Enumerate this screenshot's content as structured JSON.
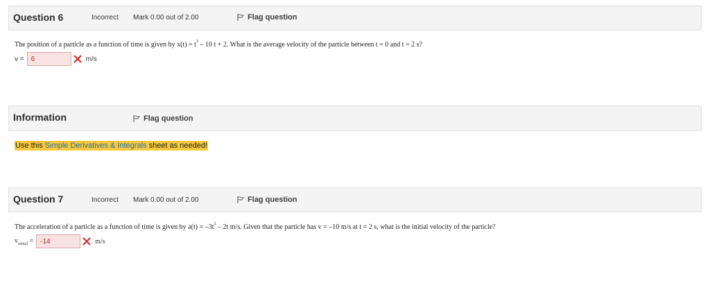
{
  "q6": {
    "title": "Question 6",
    "state": "Incorrect",
    "grade": "Mark 0.00 out of 2.00",
    "flag_label": "Flag question",
    "text_a": "The position of a particle as a function of time is given by x(t) = t",
    "text_sup": "3",
    "text_b": " – 10 t + 2.  What is the average velocity of the particle between  t = 0 and t = 2 s?",
    "answer_label": "v =",
    "answer_value": "6",
    "unit": "m/s"
  },
  "info": {
    "title": "Information",
    "flag_label": "Flag question",
    "note_prefix": "Use this ",
    "note_link": "Simple Derivatives & Integrals",
    "note_suffix": " sheet as needed!"
  },
  "q7": {
    "title": "Question 7",
    "state": "Incorrect",
    "grade": "Mark 0.00 out of 2.00",
    "flag_label": "Flag question",
    "text_a": "The acceleration of a particle as a function of time is given by a(t) = –3t",
    "text_sup": "2",
    "text_b": " – 2t m/s.  Given that the particle has  v = –10 m/s at t = 2 s, what is the initial velocity of the particle?",
    "answer_label": "v",
    "answer_sub": "initial",
    "answer_eq": "=",
    "answer_value": "-14",
    "unit": "m/s"
  },
  "colors": {
    "incorrect_bg": "#f9e2e2",
    "incorrect_text": "#b02a2a",
    "highlight": "#f7c93a",
    "link": "#1b6fb5"
  },
  "icons": {
    "flag": "flag-icon",
    "wrong": "x-icon"
  }
}
